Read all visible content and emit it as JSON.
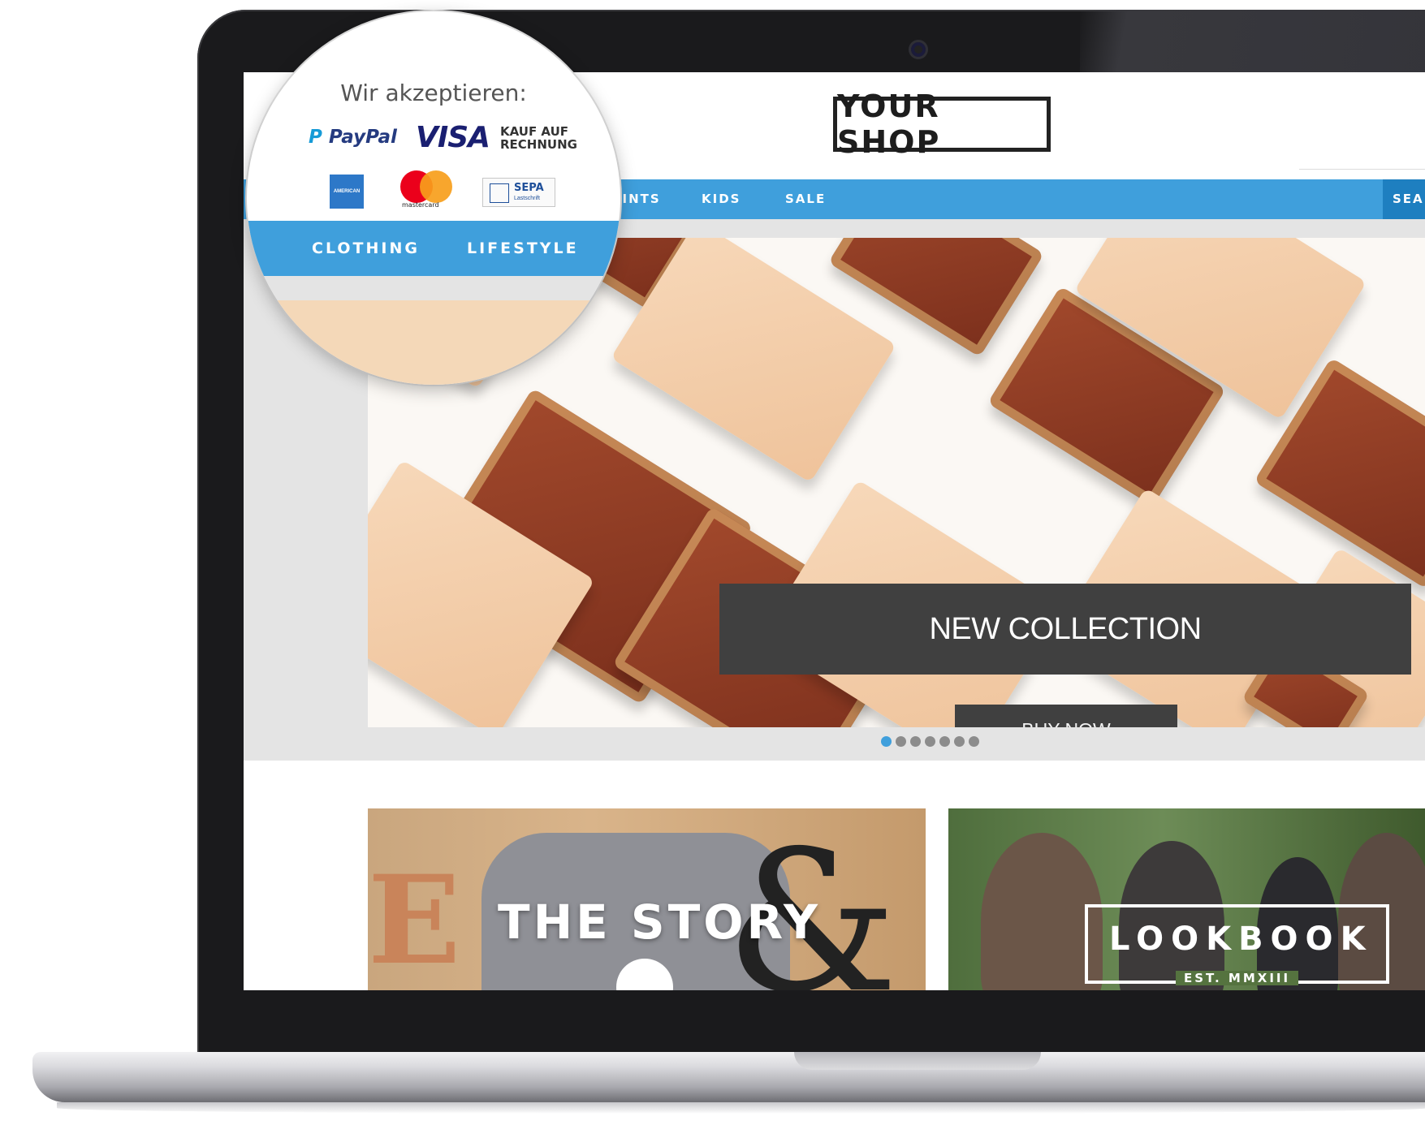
{
  "shop": {
    "logo_text": "YOUR SHOP"
  },
  "nav": {
    "items": [
      "PRINTS",
      "KIDS",
      "SALE"
    ],
    "search_label": "SEARCH"
  },
  "hero": {
    "headline": "NEW COLLECTION",
    "button_label": "BUY NOW",
    "slide_count": 7,
    "active_slide": 1
  },
  "tiles": {
    "story_title": "THE STORY",
    "lookbook_title": "LOOKBOOK",
    "lookbook_subtitle": "EST. MMXIII",
    "story_deco_letter": "E"
  },
  "magnifier": {
    "title": "Wir akzeptieren:",
    "payments": {
      "paypal": "PayPal",
      "visa": "VISA",
      "kauf_line1": "KAUF AUF",
      "kauf_line2": "RECHNUNG",
      "amex": "AMERICAN EXPRESS",
      "mastercard": "mastercard",
      "sepa": "SEPA",
      "sepa_sub": "Lastschrift"
    },
    "nav_items": [
      "CLOTHING",
      "LIFESTYLE"
    ]
  },
  "colors": {
    "nav_blue": "#3f9fdc",
    "search_blue": "#1e7fc0",
    "dark_box": "#404040",
    "active_dot": "#3f9fdc"
  }
}
